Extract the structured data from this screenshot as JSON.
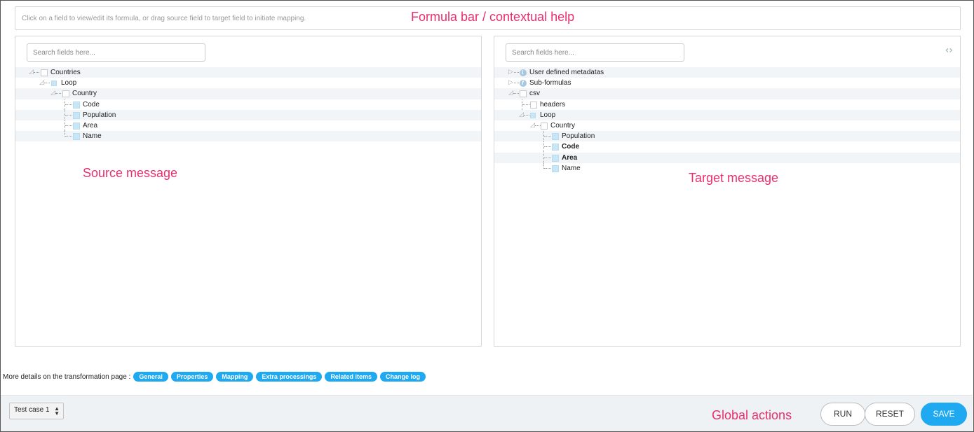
{
  "formula_bar": {
    "hint": "Click on a field to view/edit its formula, or drag source field to target field to initiate mapping."
  },
  "annotations": {
    "formula": "Formula bar / contextual help",
    "source": "Source message",
    "target": "Target message",
    "global": "Global actions"
  },
  "source_panel": {
    "search_placeholder": "Search fields here...",
    "tree": [
      {
        "label": "Countries",
        "icon": "empty-box"
      },
      {
        "label": "Loop",
        "icon": "loop-box"
      },
      {
        "label": "Country",
        "icon": "empty-box"
      },
      {
        "label": "Code",
        "icon": "filled-box"
      },
      {
        "label": "Population",
        "icon": "filled-box"
      },
      {
        "label": "Area",
        "icon": "filled-box"
      },
      {
        "label": "Name",
        "icon": "filled-box"
      }
    ]
  },
  "target_panel": {
    "search_placeholder": "Search fields here...",
    "tree": [
      {
        "label": "User defined metadatas",
        "icon": "info-icon"
      },
      {
        "label": "Sub-formulas",
        "icon": "formula-icon"
      },
      {
        "label": "csv",
        "icon": "empty-box"
      },
      {
        "label": "headers",
        "icon": "empty-box"
      },
      {
        "label": "Loop",
        "icon": "loop-box"
      },
      {
        "label": "Country",
        "icon": "empty-box"
      },
      {
        "label": "Population",
        "icon": "filled-box"
      },
      {
        "label": "Code",
        "icon": "filled-box"
      },
      {
        "label": "Area",
        "icon": "filled-box"
      },
      {
        "label": "Name",
        "icon": "filled-box"
      }
    ]
  },
  "details": {
    "text": "More details on the transformation page :",
    "links": [
      "General",
      "Properties",
      "Mapping",
      "Extra processings",
      "Related items",
      "Change log"
    ]
  },
  "footer": {
    "test_case": "Test case 1",
    "run_label": "RUN",
    "reset_label": "RESET",
    "save_label": "SAVE"
  },
  "colors": {
    "accent": "#1ea9f0",
    "annotation": "#e8306c"
  }
}
